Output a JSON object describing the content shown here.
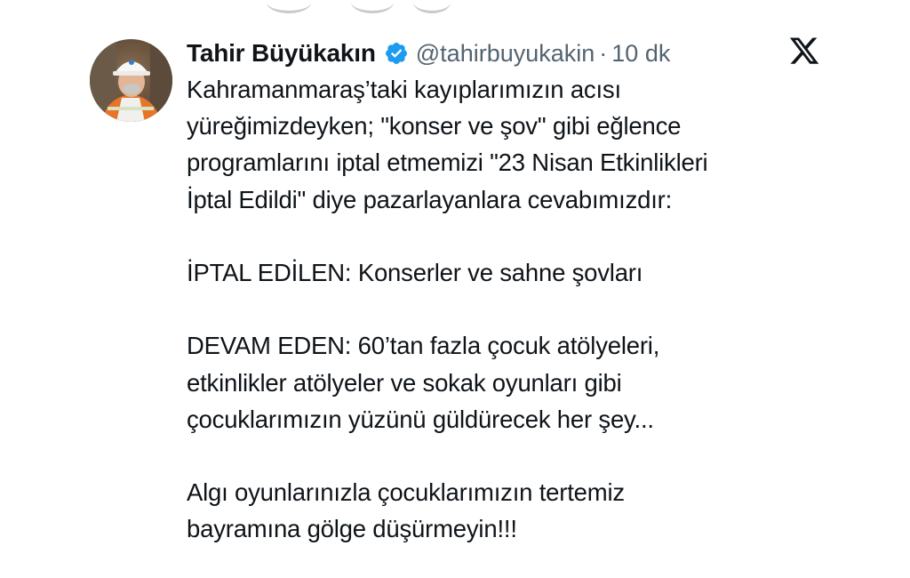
{
  "author": {
    "name": "Tahir Büyükakın",
    "handle": "@tahirbuyukakin",
    "separator": "·",
    "time": "10 dk"
  },
  "tweet": {
    "lines": [
      "Kahramanmaraş’taki kayıplarımızın acısı",
      "yüreğimizdeyken; \"konser ve şov\" gibi eğlence",
      "programlarını iptal etmemizi \"23 Nisan Etkinlikleri",
      "İptal Edildi\" diye pazarlayanlara cevabımızdır:",
      "",
      "İPTAL EDİLEN: Konserler ve sahne şovları",
      "",
      "DEVAM EDEN: 60’tan fazla çocuk atölyeleri,",
      "etkinlikler atölyeler ve sokak oyunları gibi",
      "çocuklarımızın yüzünü güldürecek her şey...",
      "",
      "Algı oyunlarınızla çocuklarımızın tertemiz",
      "bayramına gölge düşürmeyin!!!"
    ]
  },
  "icons": {
    "verified": "verified-badge-icon",
    "platform": "x-logo-icon",
    "avatar": "profile-photo"
  },
  "colors": {
    "text": "#0f1419",
    "secondary": "#536471",
    "verified": "#1d9bf0",
    "background": "#ffffff"
  }
}
